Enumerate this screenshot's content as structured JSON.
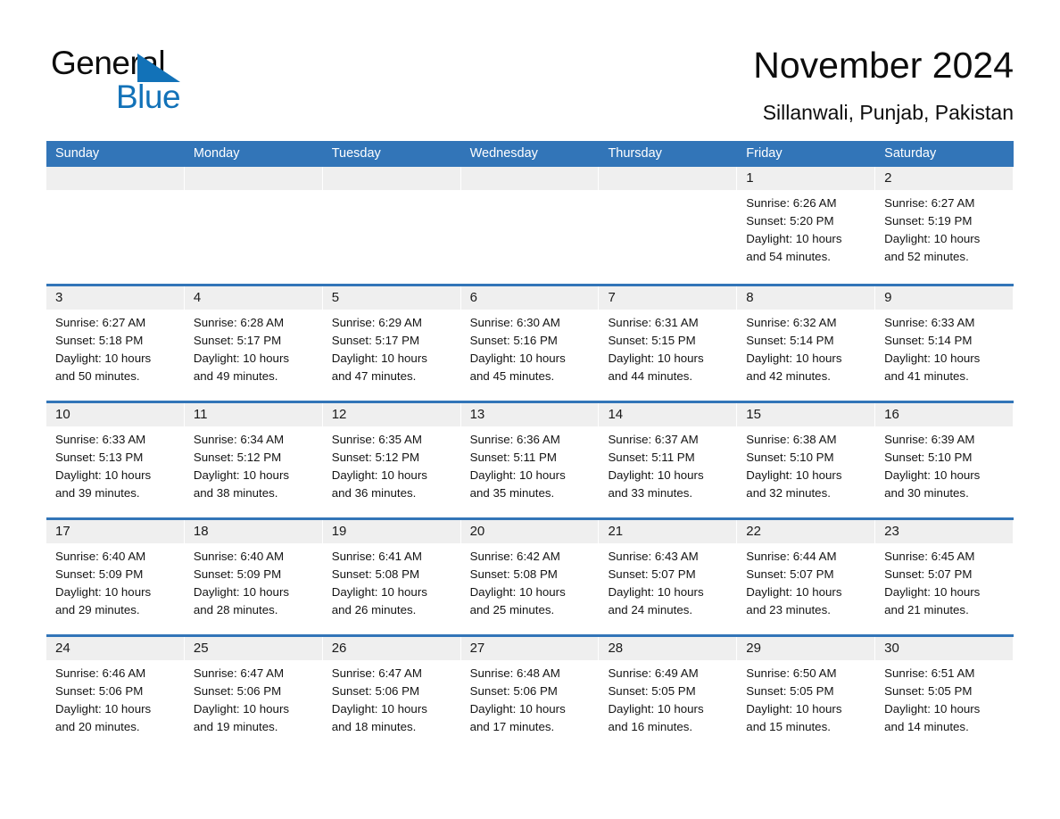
{
  "brand": {
    "name_part1": "General",
    "name_part2": "Blue",
    "accent_color": "#1272b8"
  },
  "header": {
    "month_title": "November 2024",
    "location": "Sillanwali, Punjab, Pakistan"
  },
  "theme": {
    "header_blue": "#3275b8",
    "day_band_gray": "#efefef",
    "text_color": "#141414"
  },
  "weekdays": [
    "Sunday",
    "Monday",
    "Tuesday",
    "Wednesday",
    "Thursday",
    "Friday",
    "Saturday"
  ],
  "weeks": [
    [
      {
        "day": "",
        "lines": []
      },
      {
        "day": "",
        "lines": []
      },
      {
        "day": "",
        "lines": []
      },
      {
        "day": "",
        "lines": []
      },
      {
        "day": "",
        "lines": []
      },
      {
        "day": "1",
        "lines": [
          "Sunrise: 6:26 AM",
          "Sunset: 5:20 PM",
          "Daylight: 10 hours",
          "and 54 minutes."
        ]
      },
      {
        "day": "2",
        "lines": [
          "Sunrise: 6:27 AM",
          "Sunset: 5:19 PM",
          "Daylight: 10 hours",
          "and 52 minutes."
        ]
      }
    ],
    [
      {
        "day": "3",
        "lines": [
          "Sunrise: 6:27 AM",
          "Sunset: 5:18 PM",
          "Daylight: 10 hours",
          "and 50 minutes."
        ]
      },
      {
        "day": "4",
        "lines": [
          "Sunrise: 6:28 AM",
          "Sunset: 5:17 PM",
          "Daylight: 10 hours",
          "and 49 minutes."
        ]
      },
      {
        "day": "5",
        "lines": [
          "Sunrise: 6:29 AM",
          "Sunset: 5:17 PM",
          "Daylight: 10 hours",
          "and 47 minutes."
        ]
      },
      {
        "day": "6",
        "lines": [
          "Sunrise: 6:30 AM",
          "Sunset: 5:16 PM",
          "Daylight: 10 hours",
          "and 45 minutes."
        ]
      },
      {
        "day": "7",
        "lines": [
          "Sunrise: 6:31 AM",
          "Sunset: 5:15 PM",
          "Daylight: 10 hours",
          "and 44 minutes."
        ]
      },
      {
        "day": "8",
        "lines": [
          "Sunrise: 6:32 AM",
          "Sunset: 5:14 PM",
          "Daylight: 10 hours",
          "and 42 minutes."
        ]
      },
      {
        "day": "9",
        "lines": [
          "Sunrise: 6:33 AM",
          "Sunset: 5:14 PM",
          "Daylight: 10 hours",
          "and 41 minutes."
        ]
      }
    ],
    [
      {
        "day": "10",
        "lines": [
          "Sunrise: 6:33 AM",
          "Sunset: 5:13 PM",
          "Daylight: 10 hours",
          "and 39 minutes."
        ]
      },
      {
        "day": "11",
        "lines": [
          "Sunrise: 6:34 AM",
          "Sunset: 5:12 PM",
          "Daylight: 10 hours",
          "and 38 minutes."
        ]
      },
      {
        "day": "12",
        "lines": [
          "Sunrise: 6:35 AM",
          "Sunset: 5:12 PM",
          "Daylight: 10 hours",
          "and 36 minutes."
        ]
      },
      {
        "day": "13",
        "lines": [
          "Sunrise: 6:36 AM",
          "Sunset: 5:11 PM",
          "Daylight: 10 hours",
          "and 35 minutes."
        ]
      },
      {
        "day": "14",
        "lines": [
          "Sunrise: 6:37 AM",
          "Sunset: 5:11 PM",
          "Daylight: 10 hours",
          "and 33 minutes."
        ]
      },
      {
        "day": "15",
        "lines": [
          "Sunrise: 6:38 AM",
          "Sunset: 5:10 PM",
          "Daylight: 10 hours",
          "and 32 minutes."
        ]
      },
      {
        "day": "16",
        "lines": [
          "Sunrise: 6:39 AM",
          "Sunset: 5:10 PM",
          "Daylight: 10 hours",
          "and 30 minutes."
        ]
      }
    ],
    [
      {
        "day": "17",
        "lines": [
          "Sunrise: 6:40 AM",
          "Sunset: 5:09 PM",
          "Daylight: 10 hours",
          "and 29 minutes."
        ]
      },
      {
        "day": "18",
        "lines": [
          "Sunrise: 6:40 AM",
          "Sunset: 5:09 PM",
          "Daylight: 10 hours",
          "and 28 minutes."
        ]
      },
      {
        "day": "19",
        "lines": [
          "Sunrise: 6:41 AM",
          "Sunset: 5:08 PM",
          "Daylight: 10 hours",
          "and 26 minutes."
        ]
      },
      {
        "day": "20",
        "lines": [
          "Sunrise: 6:42 AM",
          "Sunset: 5:08 PM",
          "Daylight: 10 hours",
          "and 25 minutes."
        ]
      },
      {
        "day": "21",
        "lines": [
          "Sunrise: 6:43 AM",
          "Sunset: 5:07 PM",
          "Daylight: 10 hours",
          "and 24 minutes."
        ]
      },
      {
        "day": "22",
        "lines": [
          "Sunrise: 6:44 AM",
          "Sunset: 5:07 PM",
          "Daylight: 10 hours",
          "and 23 minutes."
        ]
      },
      {
        "day": "23",
        "lines": [
          "Sunrise: 6:45 AM",
          "Sunset: 5:07 PM",
          "Daylight: 10 hours",
          "and 21 minutes."
        ]
      }
    ],
    [
      {
        "day": "24",
        "lines": [
          "Sunrise: 6:46 AM",
          "Sunset: 5:06 PM",
          "Daylight: 10 hours",
          "and 20 minutes."
        ]
      },
      {
        "day": "25",
        "lines": [
          "Sunrise: 6:47 AM",
          "Sunset: 5:06 PM",
          "Daylight: 10 hours",
          "and 19 minutes."
        ]
      },
      {
        "day": "26",
        "lines": [
          "Sunrise: 6:47 AM",
          "Sunset: 5:06 PM",
          "Daylight: 10 hours",
          "and 18 minutes."
        ]
      },
      {
        "day": "27",
        "lines": [
          "Sunrise: 6:48 AM",
          "Sunset: 5:06 PM",
          "Daylight: 10 hours",
          "and 17 minutes."
        ]
      },
      {
        "day": "28",
        "lines": [
          "Sunrise: 6:49 AM",
          "Sunset: 5:05 PM",
          "Daylight: 10 hours",
          "and 16 minutes."
        ]
      },
      {
        "day": "29",
        "lines": [
          "Sunrise: 6:50 AM",
          "Sunset: 5:05 PM",
          "Daylight: 10 hours",
          "and 15 minutes."
        ]
      },
      {
        "day": "30",
        "lines": [
          "Sunrise: 6:51 AM",
          "Sunset: 5:05 PM",
          "Daylight: 10 hours",
          "and 14 minutes."
        ]
      }
    ]
  ]
}
